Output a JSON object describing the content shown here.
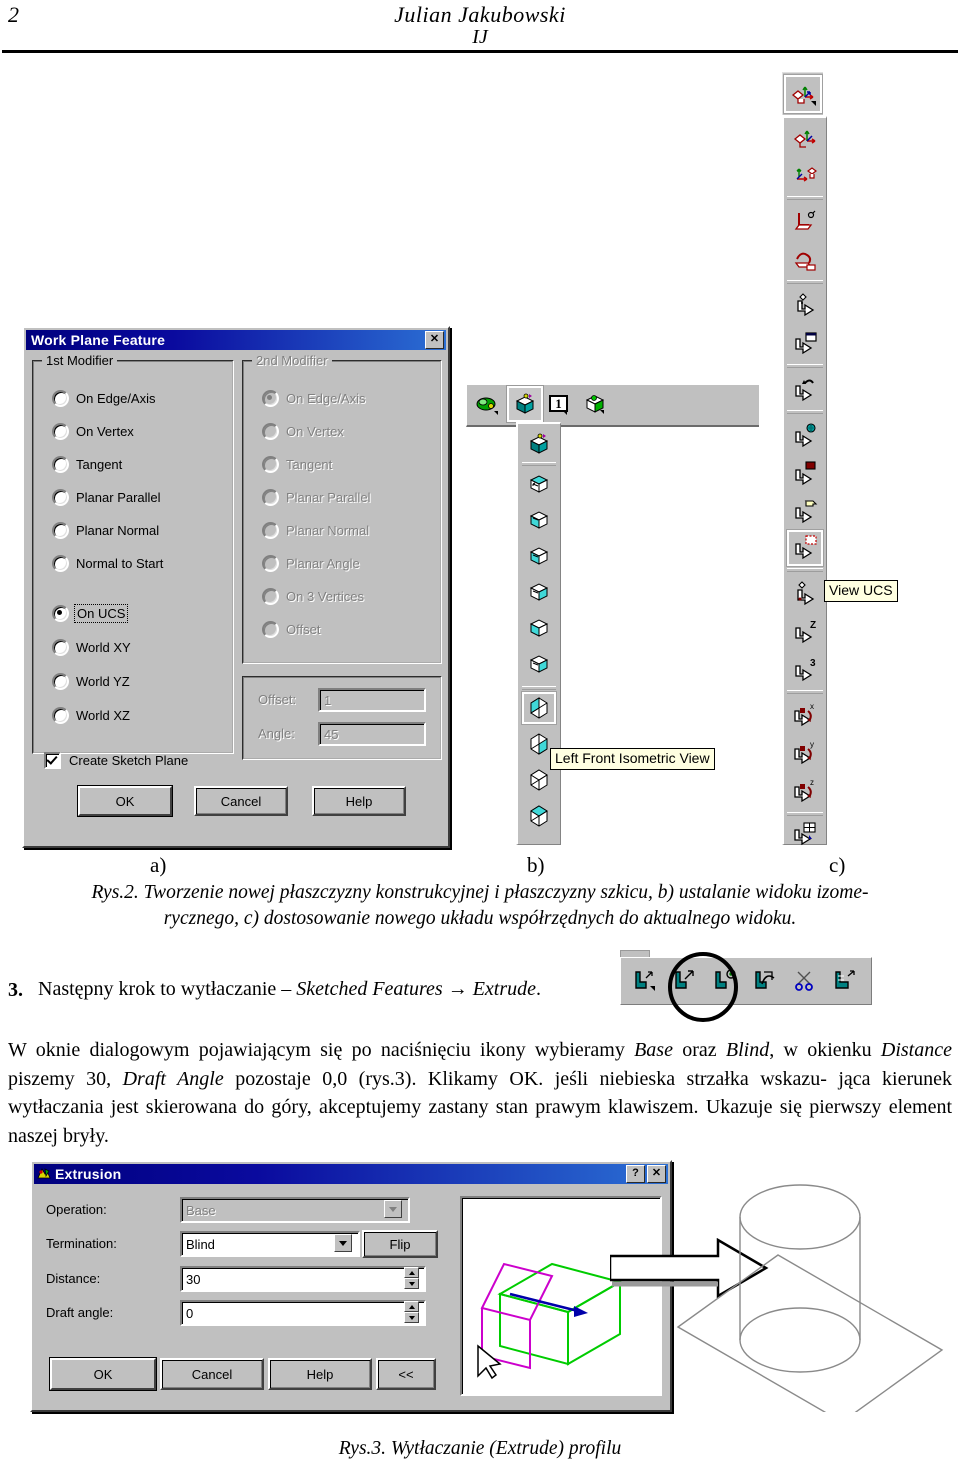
{
  "header": {
    "page_number": "2",
    "author": "Julian Jakubowski",
    "subtitle": "IJ"
  },
  "figure2": {
    "sublabels": {
      "a": "a)",
      "b": "b)",
      "c": "c)"
    },
    "caption_line1": "Rys.2. Tworzenie nowej płaszczyzny konstrukcyjnej i płaszczyzny szkicu, b) ustalanie widoku izome-",
    "caption_line2": "rycznego, c) dostosowanie nowego układu współrzędnych do aktualnego widoku."
  },
  "work_plane_dialog": {
    "title": "Work Plane Feature",
    "close_label": "✕",
    "group1": {
      "label": "1st Modifier",
      "options": [
        {
          "label": "On Edge/Axis",
          "checked": false
        },
        {
          "label": "On Vertex",
          "checked": false
        },
        {
          "label": "Tangent",
          "checked": false
        },
        {
          "label": "Planar Parallel",
          "checked": false
        },
        {
          "label": "Planar Normal",
          "checked": false
        },
        {
          "label": "Normal to Start",
          "checked": false
        },
        {
          "label": "On UCS",
          "checked": true
        },
        {
          "label": "World XY",
          "checked": false
        },
        {
          "label": "World YZ",
          "checked": false
        },
        {
          "label": "World XZ",
          "checked": false
        }
      ]
    },
    "group2": {
      "label": "2nd Modifier",
      "disabled": true,
      "options": [
        {
          "label": "On Edge/Axis",
          "checked": true
        },
        {
          "label": "On Vertex",
          "checked": false
        },
        {
          "label": "Tangent",
          "checked": false
        },
        {
          "label": "Planar Parallel",
          "checked": false
        },
        {
          "label": "Planar Normal",
          "checked": false
        },
        {
          "label": "Planar Angle",
          "checked": false
        },
        {
          "label": "On 3 Vertices",
          "checked": false
        },
        {
          "label": "Offset",
          "checked": false
        }
      ]
    },
    "offset_group": {
      "offset_label": "Offset:",
      "offset_value": "1",
      "angle_label": "Angle:",
      "angle_value": "45"
    },
    "create_sketch_plane": {
      "label": "Create Sketch Plane",
      "checked": true
    },
    "buttons": {
      "ok": "OK",
      "cancel": "Cancel",
      "help": "Help"
    }
  },
  "view_toolbar": {
    "tooltip": "Left Front Isometric View",
    "top_buttons": [
      "shade-icon",
      "work-plane-icon",
      "numbered-view-icon",
      "cube-view-icon"
    ],
    "flyout_items": [
      "work-plane-icon",
      "top-view-icon",
      "bottom-view-icon",
      "front-view-icon",
      "back-view-icon",
      "left-view-icon",
      "right-view-icon",
      "left-front-isometric-view-icon",
      "right-front-isometric-view-icon",
      "left-back-isometric-view-icon",
      "right-back-isometric-view-icon"
    ]
  },
  "ucs_toolbar": {
    "tooltip": "View UCS",
    "items": [
      "ucs-main-icon",
      "ucs-global-icon",
      "ucs-origin-icon",
      "ucs-face-icon",
      "ucs-plane-icon",
      "ucs-new-icon",
      "ucs-window-icon",
      "ucs-previous-icon",
      "ucs-world-icon",
      "ucs-object-icon",
      "ucs-sketch-icon",
      "ucs-view-icon",
      "ucs-zaxis-icon",
      "ucs-3point-icon",
      "ucs-rotate-x-icon",
      "ucs-rotate-y-icon",
      "ucs-rotate-z-icon",
      "ucs-manage-icon"
    ]
  },
  "step3": {
    "number": "3.",
    "text_before": "Następny krok to wytłaczanie – ",
    "italic1": "Sketched Features",
    "arrow": " → ",
    "italic2": "Extrude",
    "text_after": "."
  },
  "paragraph": {
    "line1_a": "W oknie dialogowym pojawiającym się po naciśnięciu ikony wybieramy ",
    "line1_i1": "Base",
    "line1_b": " oraz ",
    "line1_i2": "Blind",
    "line1_c": ", w okienku ",
    "line2_i1": "Distance",
    "line2_a": " piszemy 30, ",
    "line2_i2": "Draft Angle",
    "line2_b": " pozostaje 0,0 (rys.3). Klikamy OK. jeśli niebieska strzałka wskazu-",
    "line3": "jąca kierunek wytłaczania jest skierowana do góry, akceptujemy zastany stan prawym klawiszem.",
    "line4": "Ukazuje się pierwszy element naszej bryły."
  },
  "extrusion_dialog": {
    "title": "Extrusion",
    "help_label": "?",
    "close_label": "✕",
    "fields": {
      "operation_label": "Operation:",
      "operation_value": "Base",
      "operation_disabled": true,
      "termination_label": "Termination:",
      "termination_value": "Blind",
      "flip_label": "Flip",
      "distance_label": "Distance:",
      "distance_value": "30",
      "draft_angle_label": "Draft angle:",
      "draft_angle_value": "0"
    },
    "buttons": {
      "ok": "OK",
      "cancel": "Cancel",
      "help": "Help",
      "collapse": "<<"
    },
    "preview_colors": {
      "solid": "#00cc00",
      "profile": "#cc00cc",
      "direction_arrow": "#0000aa"
    }
  },
  "figure3": {
    "caption": "Rys.3. Wytłaczanie (Extrude) profilu"
  }
}
